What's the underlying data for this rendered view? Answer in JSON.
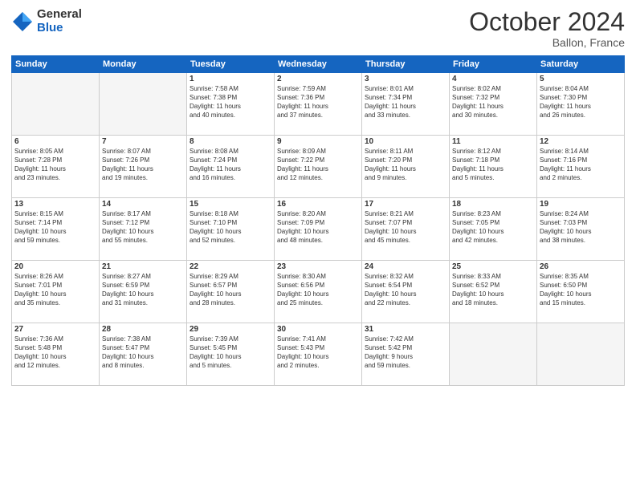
{
  "logo": {
    "general": "General",
    "blue": "Blue"
  },
  "title": "October 2024",
  "location": "Ballon, France",
  "weekdays": [
    "Sunday",
    "Monday",
    "Tuesday",
    "Wednesday",
    "Thursday",
    "Friday",
    "Saturday"
  ],
  "weeks": [
    [
      {
        "day": "",
        "info": ""
      },
      {
        "day": "",
        "info": ""
      },
      {
        "day": "1",
        "info": "Sunrise: 7:58 AM\nSunset: 7:38 PM\nDaylight: 11 hours\nand 40 minutes."
      },
      {
        "day": "2",
        "info": "Sunrise: 7:59 AM\nSunset: 7:36 PM\nDaylight: 11 hours\nand 37 minutes."
      },
      {
        "day": "3",
        "info": "Sunrise: 8:01 AM\nSunset: 7:34 PM\nDaylight: 11 hours\nand 33 minutes."
      },
      {
        "day": "4",
        "info": "Sunrise: 8:02 AM\nSunset: 7:32 PM\nDaylight: 11 hours\nand 30 minutes."
      },
      {
        "day": "5",
        "info": "Sunrise: 8:04 AM\nSunset: 7:30 PM\nDaylight: 11 hours\nand 26 minutes."
      }
    ],
    [
      {
        "day": "6",
        "info": "Sunrise: 8:05 AM\nSunset: 7:28 PM\nDaylight: 11 hours\nand 23 minutes."
      },
      {
        "day": "7",
        "info": "Sunrise: 8:07 AM\nSunset: 7:26 PM\nDaylight: 11 hours\nand 19 minutes."
      },
      {
        "day": "8",
        "info": "Sunrise: 8:08 AM\nSunset: 7:24 PM\nDaylight: 11 hours\nand 16 minutes."
      },
      {
        "day": "9",
        "info": "Sunrise: 8:09 AM\nSunset: 7:22 PM\nDaylight: 11 hours\nand 12 minutes."
      },
      {
        "day": "10",
        "info": "Sunrise: 8:11 AM\nSunset: 7:20 PM\nDaylight: 11 hours\nand 9 minutes."
      },
      {
        "day": "11",
        "info": "Sunrise: 8:12 AM\nSunset: 7:18 PM\nDaylight: 11 hours\nand 5 minutes."
      },
      {
        "day": "12",
        "info": "Sunrise: 8:14 AM\nSunset: 7:16 PM\nDaylight: 11 hours\nand 2 minutes."
      }
    ],
    [
      {
        "day": "13",
        "info": "Sunrise: 8:15 AM\nSunset: 7:14 PM\nDaylight: 10 hours\nand 59 minutes."
      },
      {
        "day": "14",
        "info": "Sunrise: 8:17 AM\nSunset: 7:12 PM\nDaylight: 10 hours\nand 55 minutes."
      },
      {
        "day": "15",
        "info": "Sunrise: 8:18 AM\nSunset: 7:10 PM\nDaylight: 10 hours\nand 52 minutes."
      },
      {
        "day": "16",
        "info": "Sunrise: 8:20 AM\nSunset: 7:09 PM\nDaylight: 10 hours\nand 48 minutes."
      },
      {
        "day": "17",
        "info": "Sunrise: 8:21 AM\nSunset: 7:07 PM\nDaylight: 10 hours\nand 45 minutes."
      },
      {
        "day": "18",
        "info": "Sunrise: 8:23 AM\nSunset: 7:05 PM\nDaylight: 10 hours\nand 42 minutes."
      },
      {
        "day": "19",
        "info": "Sunrise: 8:24 AM\nSunset: 7:03 PM\nDaylight: 10 hours\nand 38 minutes."
      }
    ],
    [
      {
        "day": "20",
        "info": "Sunrise: 8:26 AM\nSunset: 7:01 PM\nDaylight: 10 hours\nand 35 minutes."
      },
      {
        "day": "21",
        "info": "Sunrise: 8:27 AM\nSunset: 6:59 PM\nDaylight: 10 hours\nand 31 minutes."
      },
      {
        "day": "22",
        "info": "Sunrise: 8:29 AM\nSunset: 6:57 PM\nDaylight: 10 hours\nand 28 minutes."
      },
      {
        "day": "23",
        "info": "Sunrise: 8:30 AM\nSunset: 6:56 PM\nDaylight: 10 hours\nand 25 minutes."
      },
      {
        "day": "24",
        "info": "Sunrise: 8:32 AM\nSunset: 6:54 PM\nDaylight: 10 hours\nand 22 minutes."
      },
      {
        "day": "25",
        "info": "Sunrise: 8:33 AM\nSunset: 6:52 PM\nDaylight: 10 hours\nand 18 minutes."
      },
      {
        "day": "26",
        "info": "Sunrise: 8:35 AM\nSunset: 6:50 PM\nDaylight: 10 hours\nand 15 minutes."
      }
    ],
    [
      {
        "day": "27",
        "info": "Sunrise: 7:36 AM\nSunset: 5:48 PM\nDaylight: 10 hours\nand 12 minutes."
      },
      {
        "day": "28",
        "info": "Sunrise: 7:38 AM\nSunset: 5:47 PM\nDaylight: 10 hours\nand 8 minutes."
      },
      {
        "day": "29",
        "info": "Sunrise: 7:39 AM\nSunset: 5:45 PM\nDaylight: 10 hours\nand 5 minutes."
      },
      {
        "day": "30",
        "info": "Sunrise: 7:41 AM\nSunset: 5:43 PM\nDaylight: 10 hours\nand 2 minutes."
      },
      {
        "day": "31",
        "info": "Sunrise: 7:42 AM\nSunset: 5:42 PM\nDaylight: 9 hours\nand 59 minutes."
      },
      {
        "day": "",
        "info": ""
      },
      {
        "day": "",
        "info": ""
      }
    ]
  ]
}
